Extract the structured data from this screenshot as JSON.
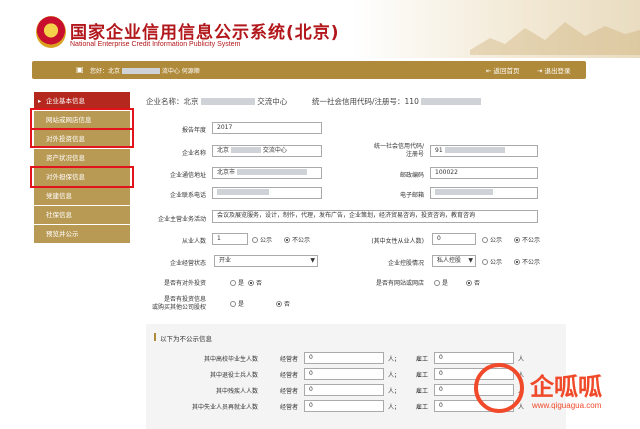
{
  "header": {
    "title_cn": "国家企业信用信息公示系统(北京)",
    "title_en": "National Enterprise Credit Information Publicity System"
  },
  "topbar": {
    "user_prefix": "您好：北京",
    "user_suffix": "流中心 何源顺",
    "back_label": "返回首页",
    "logout_label": "退出登录"
  },
  "sidebar": {
    "items": [
      {
        "label": "企业基本信息",
        "active": true
      },
      {
        "label": "网站或网店信息"
      },
      {
        "label": "对外投资信息"
      },
      {
        "label": "资产状况信息"
      },
      {
        "label": "对外担保信息"
      },
      {
        "label": "党建信息"
      },
      {
        "label": "社保信息"
      },
      {
        "label": "预览并公示"
      }
    ]
  },
  "company": {
    "name_label": "企业名称：北京",
    "name_suffix": "交流中心",
    "code_label": "统一社会信用代码/注册号：110"
  },
  "form": {
    "report_year_label": "报告年度",
    "report_year_value": "2017",
    "company_name_label": "企业名称",
    "company_name_value_a": "北京",
    "company_name_value_b": "交流中心",
    "credit_code_label_line1": "统一社会信用代码/",
    "credit_code_label_line2": "注册号",
    "credit_code_value": "91",
    "address_label": "企业通信地址",
    "address_value": "北京市",
    "postal_label": "邮政编码",
    "postal_value": "100022",
    "phone_label": "企业联系电话",
    "email_label": "电子邮箱",
    "business_label": "企业主营业务活动",
    "business_value": "会议及展览服务，设计，制作，代理，发布广告，企业策划，经济贸易咨询，投资咨询，教育咨询",
    "employees_label": "从业人数",
    "employees_value": "1",
    "female_label": "(其中女性从业人数)",
    "female_value": "0",
    "public_label": "公示",
    "not_public_label": "不公示",
    "status_label": "企业经营状态",
    "status_value": "开业",
    "holding_label": "企业控股情况",
    "holding_value": "私人控股",
    "invest_label": "是否有对外投资",
    "website_label": "是否有网站或网店",
    "equity_label_line1": "是否有投资信息",
    "equity_label_line2": "或购买其他公司股权",
    "yes_label": "是",
    "no_label": "否"
  },
  "panel": {
    "title": "以下为不公示信息",
    "rows": [
      {
        "label": "其中高校毕业生人数",
        "manager_label": "经营者",
        "manager_value": "0",
        "unit1": "人；",
        "worker_label": "雇工",
        "worker_value": "0",
        "unit2": "人"
      },
      {
        "label": "其中退役士兵人数",
        "manager_label": "经营者",
        "manager_value": "0",
        "unit1": "人；",
        "worker_label": "雇工",
        "worker_value": "0",
        "unit2": "人"
      },
      {
        "label": "其中残疾人人数",
        "manager_label": "经营者",
        "manager_value": "0",
        "unit1": "人；",
        "worker_label": "雇工",
        "worker_value": "0",
        "unit2": "人"
      },
      {
        "label": "其中失业人员再就业人数",
        "manager_label": "经营者",
        "manager_value": "0",
        "unit1": "人；",
        "worker_label": "雇工",
        "worker_value": "0",
        "unit2": "人"
      }
    ]
  },
  "watermark": {
    "brand": "企呱呱",
    "url": "www.qiguagua.com"
  },
  "colors": {
    "brand_red": "#b2171c",
    "gold": "#b08a3b",
    "highlight_red": "#e2141b",
    "watermark_orange": "#f04a2a"
  }
}
